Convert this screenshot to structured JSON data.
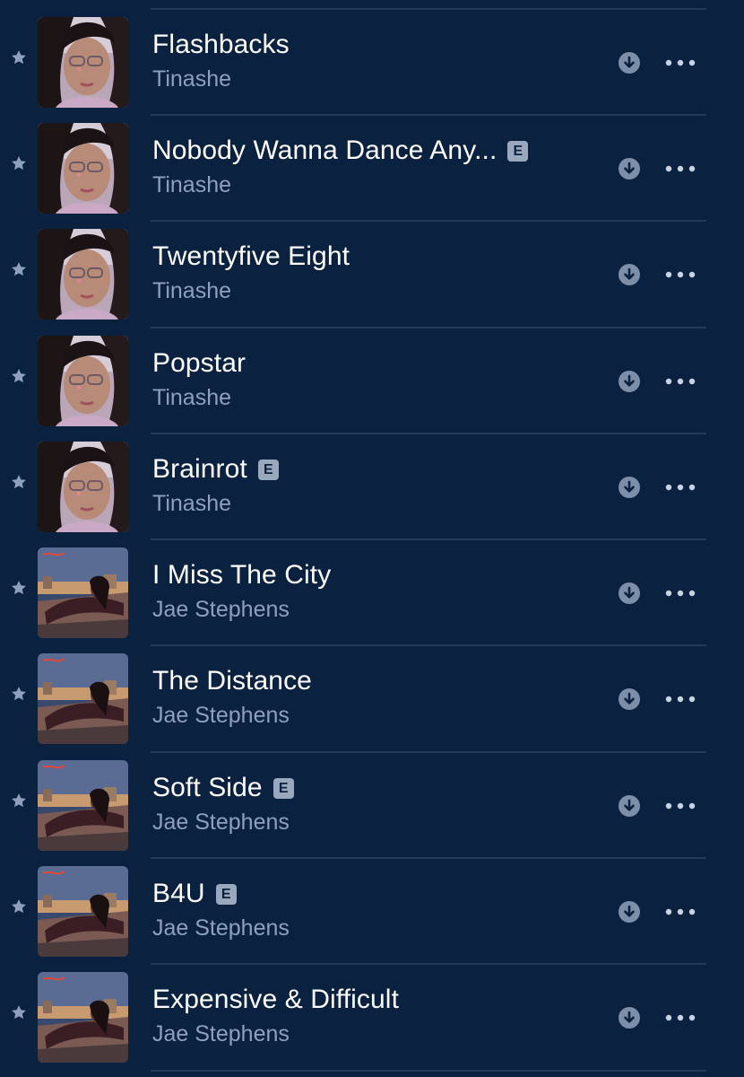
{
  "colors": {
    "background": "#0b2140",
    "title_text": "#ffffff",
    "artist_text": "#8ea0bb",
    "icon": "#8ea0bb",
    "divider": "#233a5b",
    "explicit_badge": "#9aa8bd"
  },
  "icons": {
    "favorite": "star-icon",
    "download": "download-icon",
    "more": "more-options-icon"
  },
  "tracks": [
    {
      "title": "Flashbacks",
      "artist": "Tinashe",
      "explicit": false,
      "badge": "",
      "art": "tinashe"
    },
    {
      "title": "Nobody Wanna Dance Any...",
      "artist": "Tinashe",
      "explicit": true,
      "badge": "E",
      "art": "tinashe"
    },
    {
      "title": "Twentyfive Eight",
      "artist": "Tinashe",
      "explicit": false,
      "badge": "",
      "art": "tinashe"
    },
    {
      "title": "Popstar",
      "artist": "Tinashe",
      "explicit": false,
      "badge": "",
      "art": "tinashe"
    },
    {
      "title": "Brainrot",
      "artist": "Tinashe",
      "explicit": true,
      "badge": "E",
      "art": "tinashe"
    },
    {
      "title": "I Miss The City",
      "artist": "Jae Stephens",
      "explicit": false,
      "badge": "",
      "art": "jae"
    },
    {
      "title": "The Distance",
      "artist": "Jae Stephens",
      "explicit": false,
      "badge": "",
      "art": "jae"
    },
    {
      "title": "Soft Side",
      "artist": "Jae Stephens",
      "explicit": true,
      "badge": "E",
      "art": "jae"
    },
    {
      "title": "B4U",
      "artist": "Jae Stephens",
      "explicit": true,
      "badge": "E",
      "art": "jae"
    },
    {
      "title": "Expensive & Difficult",
      "artist": "Jae Stephens",
      "explicit": false,
      "badge": "",
      "art": "jae"
    }
  ]
}
